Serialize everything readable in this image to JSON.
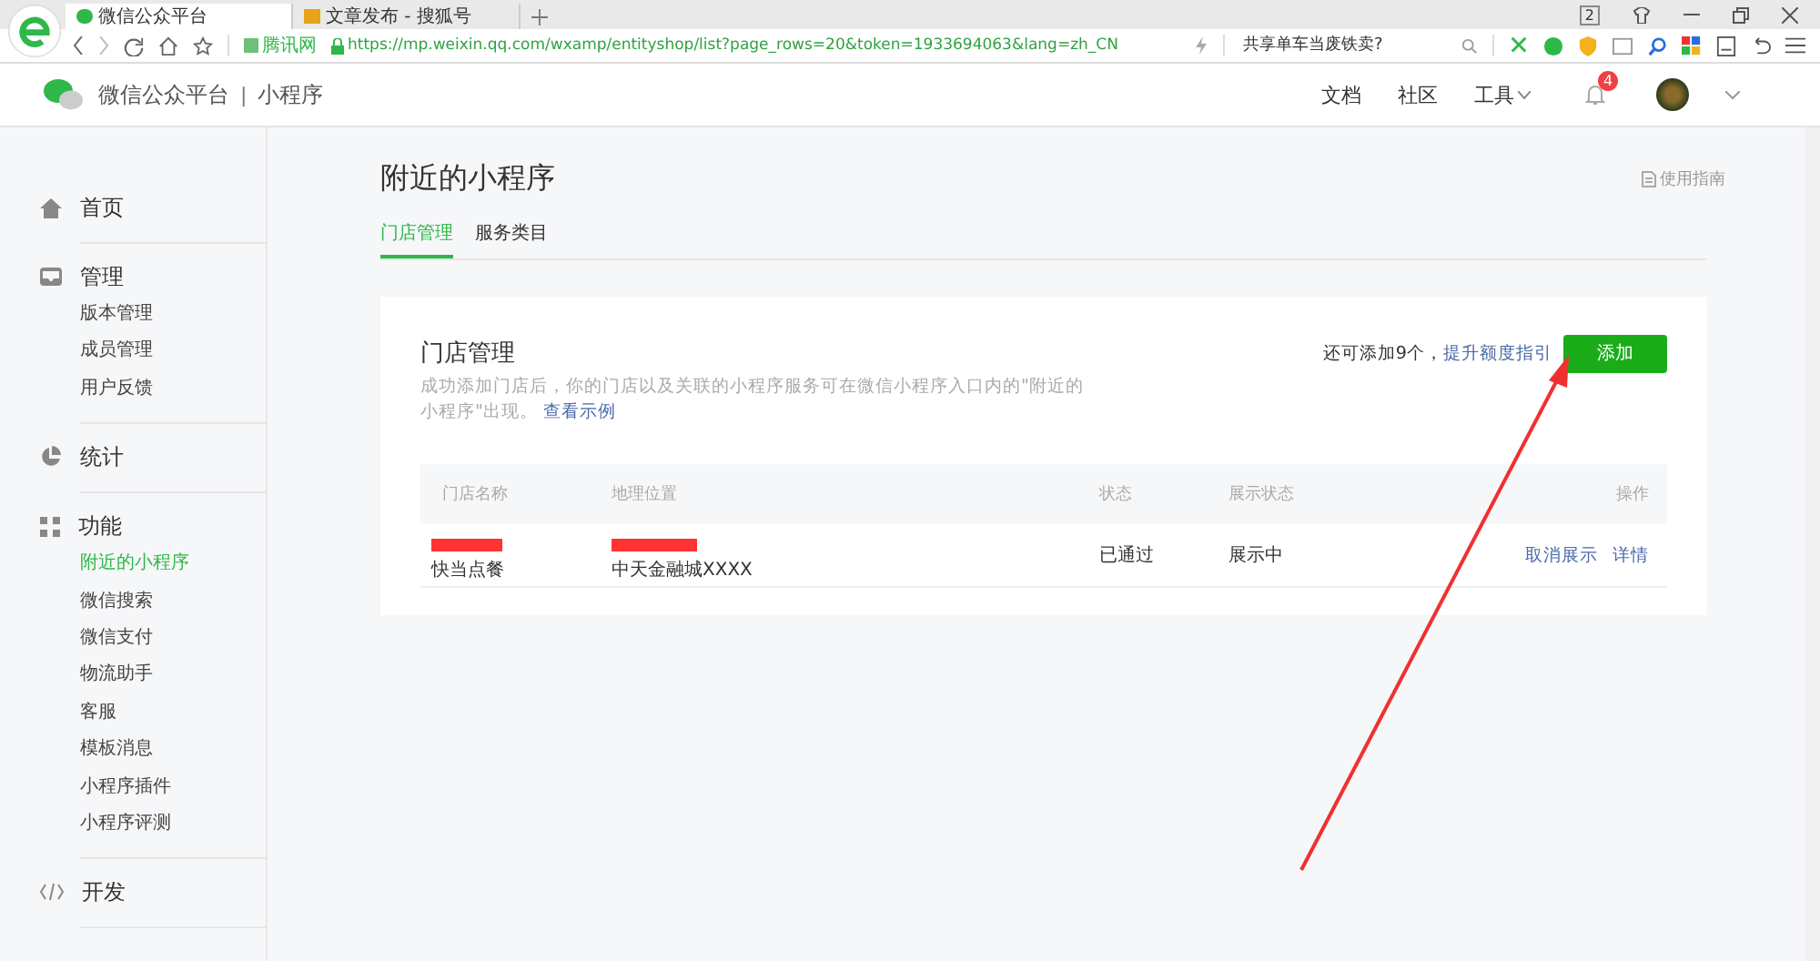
{
  "browser": {
    "tabs": [
      {
        "title": "微信公众平台",
        "selected": true
      },
      {
        "title": "文章发布 - 搜狐号",
        "selected": false
      }
    ],
    "window_count": "2",
    "site_label": "腾讯网",
    "url": "https://mp.weixin.qq.com/wxamp/entityshop/list?page_rows=20&token=1933694063&lang=zh_CN",
    "search_placeholder": "共享单车当废铁卖?"
  },
  "header": {
    "brand": "微信公众平台",
    "separator": "|",
    "product": "小程序",
    "nav": [
      "文档",
      "社区",
      "工具"
    ],
    "notification_count": "4"
  },
  "sidebar": [
    {
      "label": "首页",
      "kind": "home"
    },
    {
      "label": "管理",
      "kind": "inbox",
      "items": [
        {
          "label": "版本管理",
          "selected": false
        },
        {
          "label": "成员管理",
          "selected": false
        },
        {
          "label": "用户反馈",
          "selected": false
        }
      ]
    },
    {
      "label": "统计",
      "kind": "pie"
    },
    {
      "label": "功能",
      "kind": "grid",
      "items": [
        {
          "label": "附近的小程序",
          "selected": true
        },
        {
          "label": "微信搜索",
          "selected": false
        },
        {
          "label": "微信支付",
          "selected": false
        },
        {
          "label": "物流助手",
          "selected": false
        },
        {
          "label": "客服",
          "selected": false
        },
        {
          "label": "模板消息",
          "selected": false
        },
        {
          "label": "小程序插件",
          "selected": false
        },
        {
          "label": "小程序评测",
          "selected": false
        }
      ]
    },
    {
      "label": "开发",
      "kind": "code"
    }
  ],
  "page": {
    "title": "附近的小程序",
    "guide_link": "使用指南",
    "tabs": [
      {
        "label": "门店管理",
        "selected": true
      },
      {
        "label": "服务类目",
        "selected": false
      }
    ],
    "card": {
      "title": "门店管理",
      "description": "成功添加门店后，你的门店以及关联的小程序服务可在微信小程序入口内的\"附近的小程序\"出现。",
      "example_link": "查看示例",
      "quota_text": "还可添加9个，",
      "quota_link": "提升额度指引",
      "add_button": "添加",
      "columns": [
        "门店名称",
        "地理位置",
        "状态",
        "展示状态",
        "操作"
      ],
      "rows": [
        {
          "name": "快当点餐",
          "address": "中天金融城XXXX",
          "status": "已通过",
          "display_status": "展示中",
          "actions": [
            "取消展示",
            "详情"
          ]
        }
      ]
    }
  }
}
